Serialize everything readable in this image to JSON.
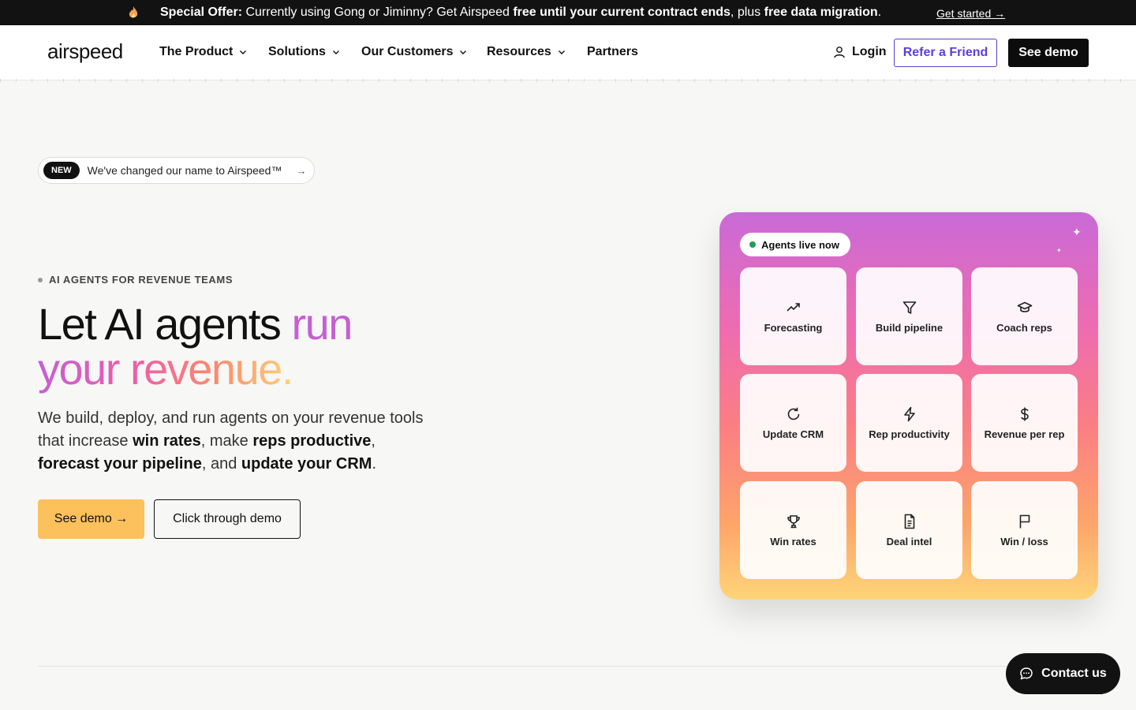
{
  "promo": {
    "prefix": "Special Offer:",
    "text1": " Currently using Gong or Jiminny? Get Airspeed ",
    "bold1": "free until your current contract ends",
    "text2": ", plus ",
    "bold2": "free data migration",
    "text3": ".",
    "cta": "Get started →"
  },
  "nav": {
    "logo": "airspeed",
    "items": [
      {
        "label": "The Product",
        "has_menu": true
      },
      {
        "label": "Solutions",
        "has_menu": true
      },
      {
        "label": "Our Customers",
        "has_menu": true
      },
      {
        "label": "Resources",
        "has_menu": true
      },
      {
        "label": "Partners",
        "has_menu": false
      }
    ],
    "login": "Login",
    "refer": "Refer a Friend",
    "demo": "See demo"
  },
  "hero": {
    "badge": "NEW",
    "announcement": "We've changed our name to Airspeed™",
    "eyebrow": "AI AGENTS FOR REVENUE TEAMS",
    "title_plain": "Let AI agents ",
    "title_accent1": "run",
    "title_accent2": "your revenue.",
    "sub": {
      "t1": "We build, deploy, and run agents on your revenue tools that increase ",
      "b1": "win rates",
      "t2": ", make ",
      "b2": "reps productive",
      "t3": ", ",
      "b3": "forecast your pipeline",
      "t4": ", and ",
      "b4": "update your CRM",
      "t5": "."
    },
    "primary_button": "See demo →",
    "secondary_button": "Click through demo"
  },
  "agents": {
    "status": "Agents live now",
    "tiles": [
      {
        "label": "Forecasting",
        "icon": "trending-up-icon"
      },
      {
        "label": "Build pipeline",
        "icon": "funnel-icon"
      },
      {
        "label": "Coach reps",
        "icon": "graduation-cap-icon"
      },
      {
        "label": "Update CRM",
        "icon": "refresh-icon"
      },
      {
        "label": "Rep productivity",
        "icon": "lightning-icon"
      },
      {
        "label": "Revenue per rep",
        "icon": "dollar-icon"
      },
      {
        "label": "Win rates",
        "icon": "trophy-icon"
      },
      {
        "label": "Deal intel",
        "icon": "document-icon"
      },
      {
        "label": "Win / loss",
        "icon": "flag-icon"
      }
    ],
    "colors": {
      "top": "#c96ad7",
      "middle": "#fb7e84",
      "bottom": "#fed479"
    }
  },
  "contact": {
    "label": "Contact us"
  },
  "colors": {
    "accent": "#5b3fd6",
    "cta": "#fcc05d",
    "dark": "#121212"
  }
}
